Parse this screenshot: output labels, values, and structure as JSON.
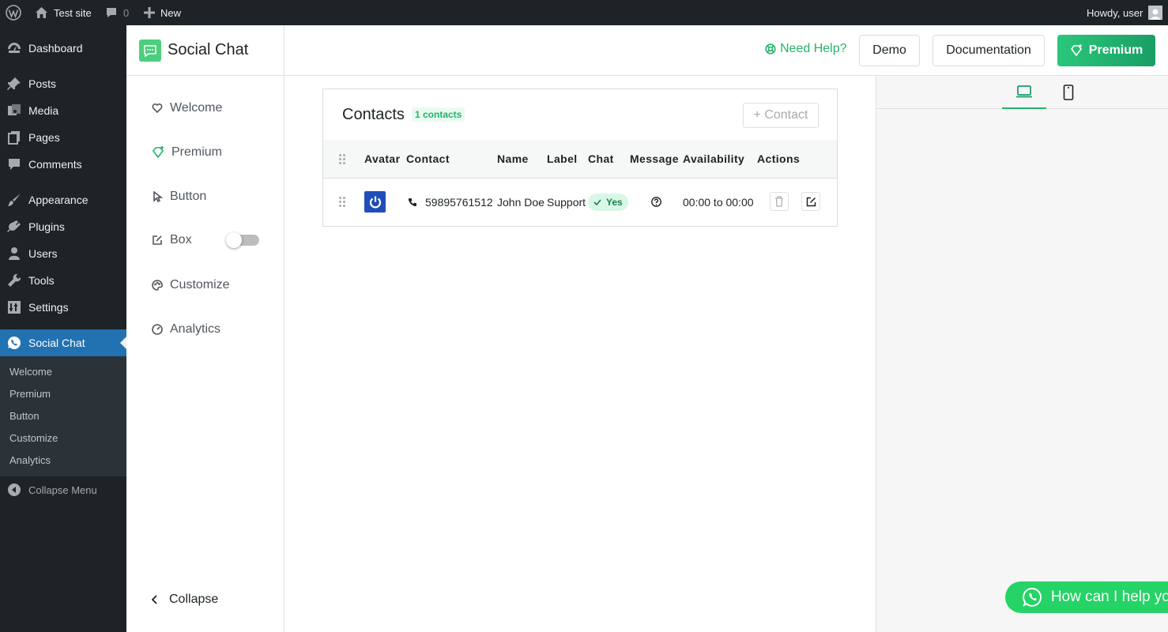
{
  "adminbar": {
    "site_name": "Test site",
    "comments_count": "0",
    "new_label": "New",
    "greeting": "Howdy, user"
  },
  "admin_menu": {
    "items": [
      {
        "label": "Dashboard",
        "icon": "dashboard-icon"
      },
      {
        "label": "Posts",
        "icon": "pin-icon"
      },
      {
        "label": "Media",
        "icon": "media-icon"
      },
      {
        "label": "Pages",
        "icon": "pages-icon"
      },
      {
        "label": "Comments",
        "icon": "comment-icon"
      },
      {
        "label": "Appearance",
        "icon": "brush-icon"
      },
      {
        "label": "Plugins",
        "icon": "plug-icon"
      },
      {
        "label": "Users",
        "icon": "user-icon"
      },
      {
        "label": "Tools",
        "icon": "wrench-icon"
      },
      {
        "label": "Settings",
        "icon": "settings-icon"
      },
      {
        "label": "Social Chat",
        "icon": "whatsapp-icon"
      }
    ],
    "submenu": [
      "Welcome",
      "Premium",
      "Button",
      "Customize",
      "Analytics"
    ],
    "collapse_label": "Collapse Menu"
  },
  "plugin_sidebar": {
    "title": "Social Chat",
    "nav": [
      {
        "label": "Welcome",
        "icon": "heart-icon"
      },
      {
        "label": "Premium",
        "icon": "diamond-icon"
      },
      {
        "label": "Button",
        "icon": "pointer-icon"
      },
      {
        "label": "Box",
        "icon": "edit-icon"
      },
      {
        "label": "Customize",
        "icon": "palette-icon"
      },
      {
        "label": "Analytics",
        "icon": "gauge-icon"
      }
    ],
    "box_toggle_on": false,
    "collapse_label": "Collapse"
  },
  "header": {
    "need_help": "Need Help?",
    "demo": "Demo",
    "documentation": "Documentation",
    "premium": "Premium"
  },
  "contacts": {
    "title": "Contacts",
    "count_badge": "1 contacts",
    "add_button": "+ Contact",
    "columns": [
      "Avatar",
      "Contact",
      "Name",
      "Label",
      "Chat",
      "Message",
      "Availability",
      "Actions"
    ],
    "rows": [
      {
        "phone": "59895761512",
        "name": "John Doe",
        "label": "Support",
        "chat": "Yes",
        "availability": "00:00 to 00:00"
      }
    ]
  },
  "preview": {
    "tabs": [
      "laptop-icon",
      "mobile-icon"
    ],
    "bubble_text": "How can I help you?"
  },
  "colors": {
    "accent": "#26b36b",
    "admin_dark": "#1d2327",
    "admin_active": "#2271b1",
    "whatsapp": "#25d366"
  }
}
